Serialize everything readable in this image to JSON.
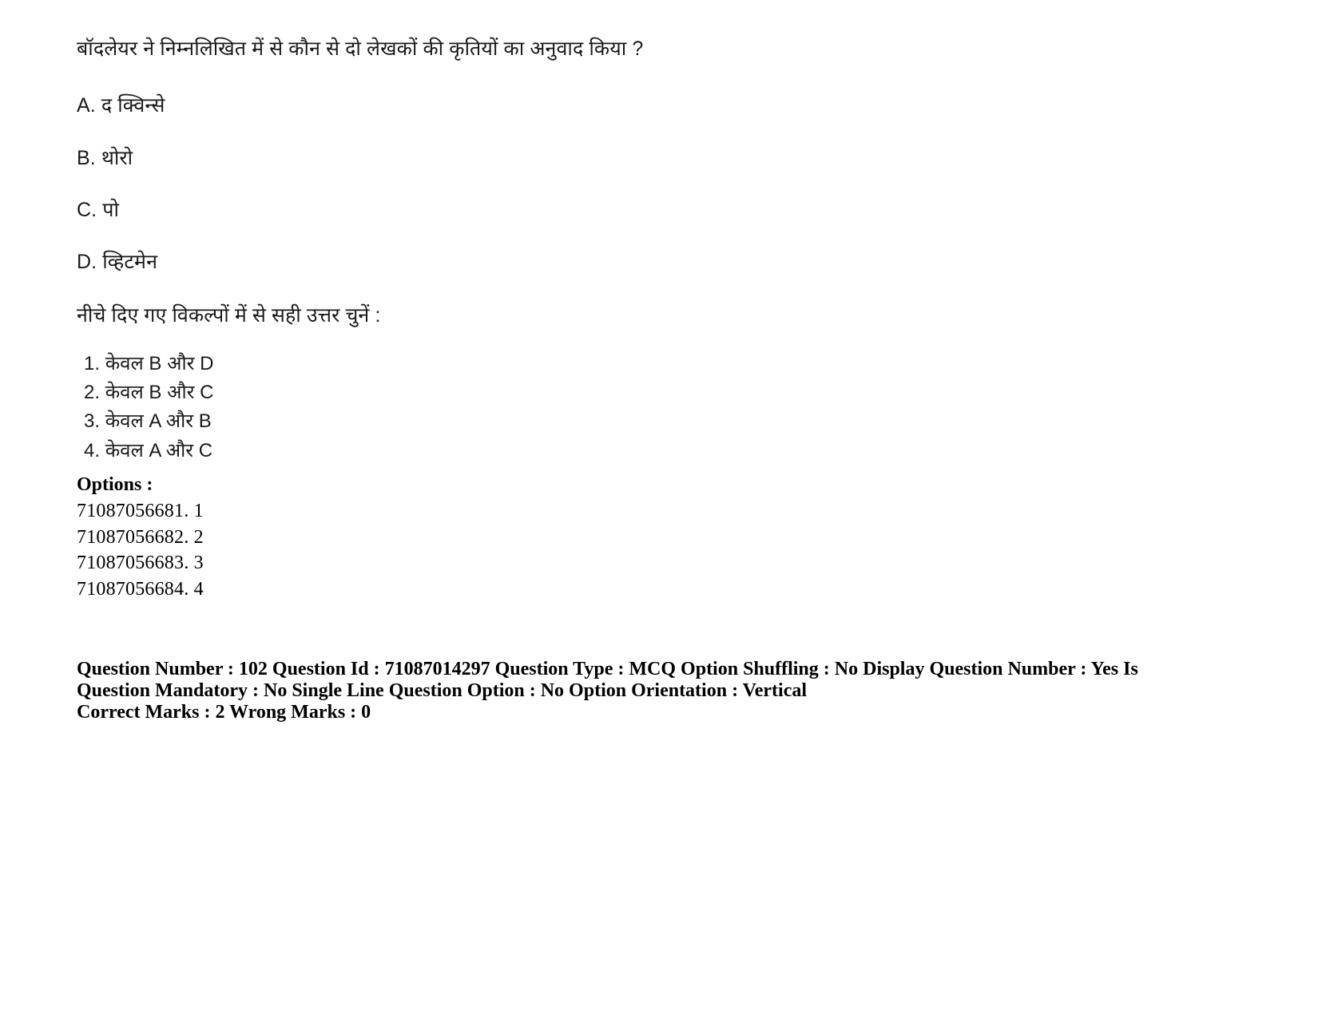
{
  "document": {
    "question_stem": "बॉदलेयर ने निम्नलिखित  में से कौन से दो लेखकों की कृतियों का अनुवाद किया ?",
    "statements": [
      {
        "label": "A.",
        "text": "द क्विन्से"
      },
      {
        "label": "B.",
        "text": "थोरो"
      },
      {
        "label": "C.",
        "text": "पो"
      },
      {
        "label": "D.",
        "text": "व्हिटमेन"
      }
    ],
    "instruction": "नीचे दिए गए विकल्पों में से सही उत्तर चुनें :",
    "answer_choices": [
      {
        "number": "1.",
        "text": "केवल B और D"
      },
      {
        "number": "2.",
        "text": "केवल B और C"
      },
      {
        "number": "3.",
        "text": "केवल A और B"
      },
      {
        "number": "4.",
        "text": "केवल A और C"
      }
    ],
    "options_label": "Options :",
    "option_codes": [
      "71087056681. 1",
      "71087056682. 2",
      "71087056683. 3",
      "71087056684. 4"
    ],
    "metadata": {
      "line1": "Question Number : 102 Question Id : 71087014297 Question Type : MCQ Option Shuffling : No Display Question Number : Yes Is Question Mandatory : No Single Line Question Option : No Option Orientation : Vertical",
      "line2": "Correct Marks : 2 Wrong Marks : 0"
    }
  }
}
